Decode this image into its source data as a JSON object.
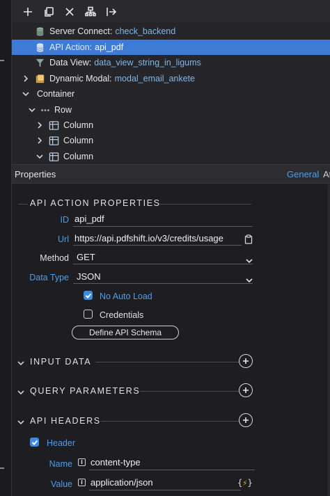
{
  "toolbar": {
    "icons": [
      "plus-icon",
      "copy-icon",
      "close-icon",
      "tree-structure-icon",
      "export-icon"
    ]
  },
  "tree": {
    "items": [
      {
        "label": "Server Connect:",
        "value": "check_backend",
        "icon": "database-icon"
      },
      {
        "label": "API Action:",
        "value": "api_pdf",
        "icon": "database-icon",
        "selected": true
      },
      {
        "label": "Data View:",
        "value": "data_view_string_in_ligums",
        "icon": "filter-icon"
      },
      {
        "label": "Dynamic Modal:",
        "value": "modal_email_ankete",
        "icon": "modal-icon"
      },
      {
        "label": "Container",
        "value": "",
        "icon": ""
      },
      {
        "label": "Row",
        "value": "",
        "icon": "dots-icon"
      },
      {
        "label": "Column",
        "value": "",
        "icon": "column-icon"
      },
      {
        "label": "Column",
        "value": "",
        "icon": "column-icon"
      },
      {
        "label": "Column",
        "value": "",
        "icon": "column-icon"
      }
    ]
  },
  "properties": {
    "title": "Properties",
    "tab_general": "General",
    "tab_other": "At"
  },
  "api_action": {
    "section_title": "API ACTION PROPERTIES",
    "id_label": "ID",
    "id_value": "api_pdf",
    "url_label": "Url",
    "url_value": "https://api.pdfshift.io/v3/credits/usage",
    "method_label": "Method",
    "method_value": "GET",
    "datatype_label": "Data Type",
    "datatype_value": "JSON",
    "no_auto_load_label": "No Auto Load",
    "no_auto_load_checked": true,
    "credentials_label": "Credentials",
    "credentials_checked": false,
    "define_schema_label": "Define API Schema"
  },
  "sections": {
    "input_data": "INPUT DATA",
    "query_parameters": "QUERY PARAMETERS",
    "api_headers": "API HEADERS"
  },
  "header": {
    "label": "Header",
    "checked": true,
    "name_label": "Name",
    "name_value": "content-type",
    "value_label": "Value",
    "value_value": "application/json",
    "info_glyph": "i",
    "bolt_open": "{",
    "bolt_glyph": "⚡",
    "bolt_close": "}"
  },
  "colors": {
    "accent": "#3d7bd6",
    "link_blue": "#4f9de8",
    "background": "#1e1e22"
  }
}
